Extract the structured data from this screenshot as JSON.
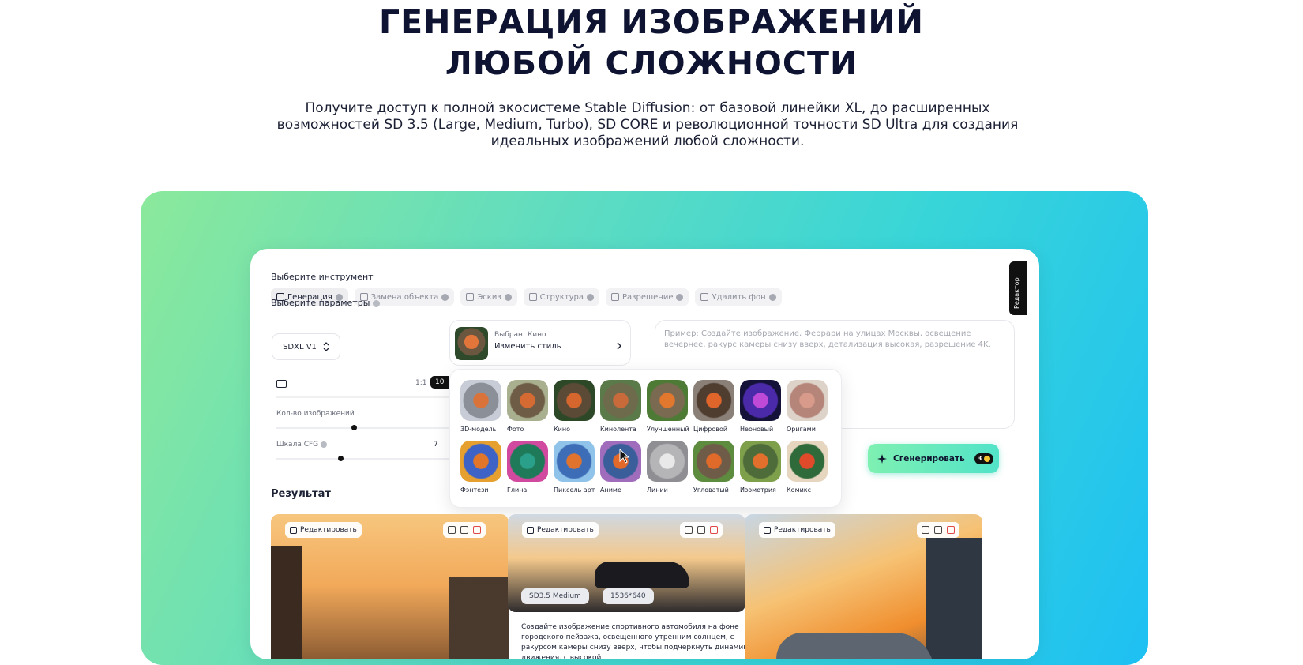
{
  "hero": {
    "title_line1": "ГЕНЕРАЦИЯ ИЗОБРАЖЕНИЙ",
    "title_line2": "ЛЮБОЙ СЛОЖНОСТИ",
    "subtitle_line1": "Получите доступ к полной экосистеме Stable Diffusion: от базовой линейки XL, до расширенных",
    "subtitle_line2": "возможностей SD 3.5 (Large, Medium, Turbo), SD CORE и революционной точности SD Ultra для создания",
    "subtitle_line3": "идеальных изображений любой сложности."
  },
  "app": {
    "tool_label": "Выберите инструмент",
    "tools": [
      {
        "label": "Генерация",
        "active": true
      },
      {
        "label": "Замена объекта",
        "active": false
      },
      {
        "label": "Эскиз",
        "active": false
      },
      {
        "label": "Структура",
        "active": false
      },
      {
        "label": "Разрешение",
        "active": false
      },
      {
        "label": "Удалить фон",
        "active": false
      }
    ],
    "params_label": "Выберите параметры",
    "model_value": "SDXL V1",
    "ratio_left": "1:1",
    "ratio_right": "10",
    "count_label": "Кол-во изображений",
    "cfg_label": "Шкала CFG",
    "cfg_value": "7",
    "style_selected": "Выбран: Кино",
    "style_change": "Изменить стиль",
    "prompt_placeholder": "Пример: Создайте изображение, Феррари на улицах Москвы, освещение вечернее, ракурс камеры снизу вверх, детализация высокая, разрешение 4K.",
    "styles_row1": [
      "3D-модель",
      "Фото",
      "Кино",
      "Кинолента",
      "Улучшенный",
      "Цифровой",
      "Неоновый",
      "Оригами"
    ],
    "styles_row2": [
      "Фэнтези",
      "Глина",
      "Пиксель арт",
      "Аниме",
      "Линии",
      "Угловатый",
      "Изометрия",
      "Комикс"
    ],
    "generate_label": "Сгенерировать",
    "generate_count": "3",
    "editor_tab": "Редактор",
    "result_title": "Результат",
    "edit_label": "Редактировать",
    "tag_model": "SD3.5 Medium",
    "tag_size": "1536*640",
    "result_desc": "Создайте изображение спортивного автомобиля на фоне городского пейзажа, освещенного утренним солнцем, с ракурсом камеры снизу вверх, чтобы подчеркнуть динамику движения, с высокой"
  },
  "colors": {
    "accent_green": "#7ef0b2",
    "banner_start": "#8be99b",
    "banner_end": "#1ec0f3",
    "title": "#0d1330"
  }
}
